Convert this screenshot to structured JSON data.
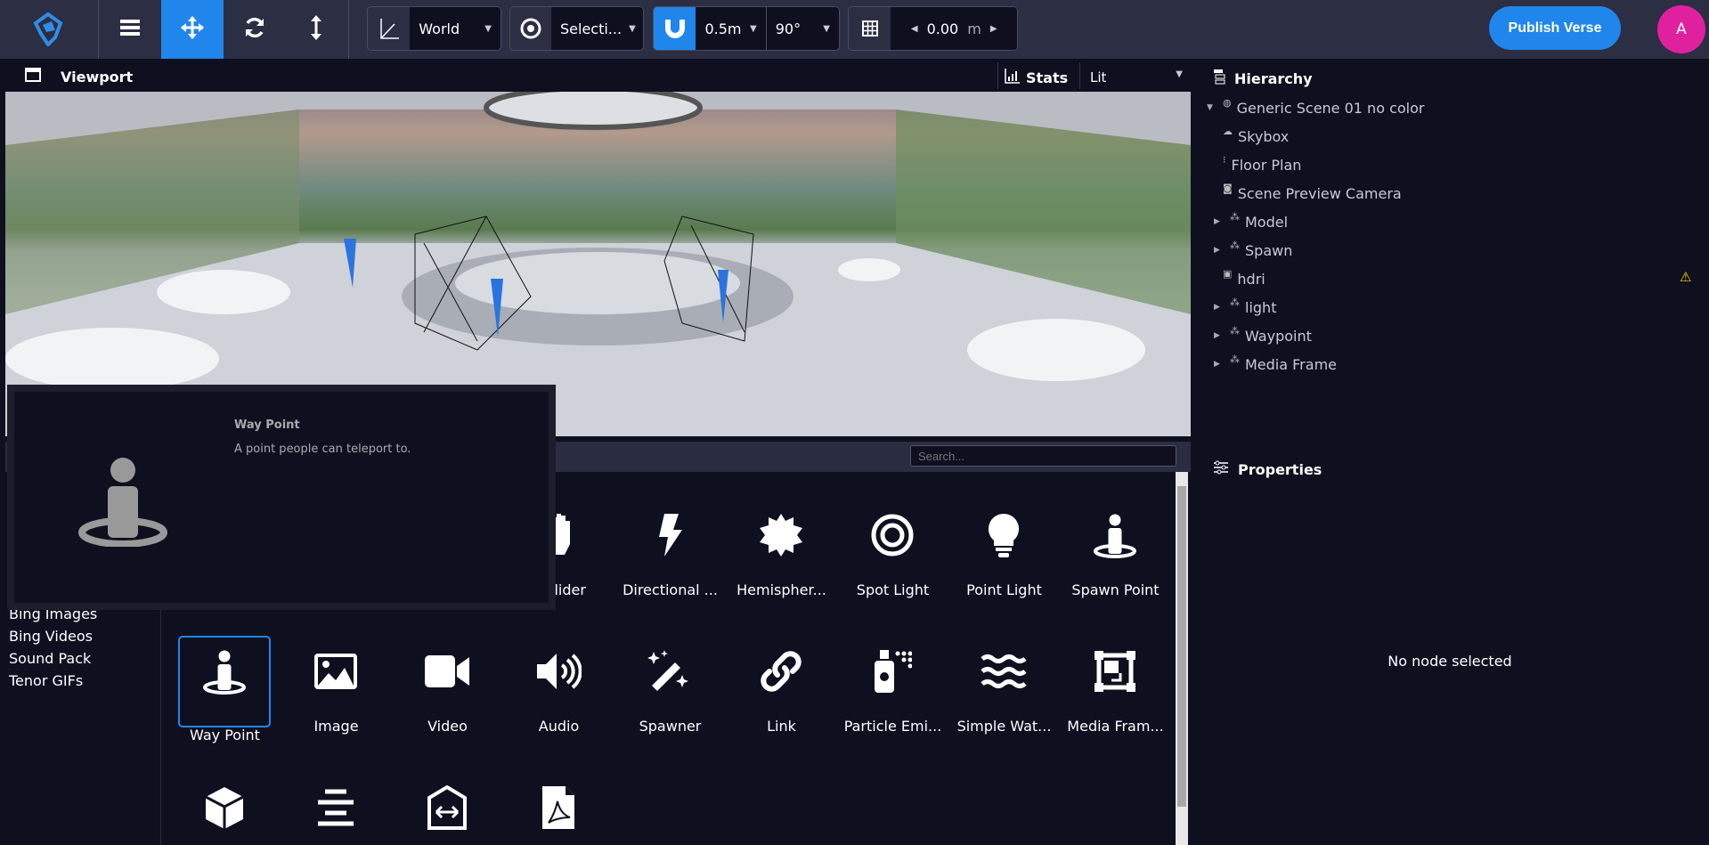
{
  "toolbar": {
    "transform_space": "World",
    "pivot": "Selecti...",
    "snap_distance": "0.5m",
    "snap_angle": "90°",
    "grid_value": "0.00",
    "grid_unit": "m",
    "publish_label": "Publish Verse",
    "avatar_initial": "A",
    "accent": "#2186eb"
  },
  "viewport": {
    "title": "Viewport",
    "stats_label": "Stats",
    "render_mode": "Lit"
  },
  "hierarchy": {
    "title": "Hierarchy",
    "items": [
      {
        "label": "Generic Scene 01 no color",
        "icon": "globe-icon",
        "expander": "expanded"
      },
      {
        "label": "Skybox",
        "icon": "cloud-icon"
      },
      {
        "label": "Floor Plan",
        "icon": "floor-plan-icon"
      },
      {
        "label": "Scene Preview Camera",
        "icon": "camera-icon"
      },
      {
        "label": "Model",
        "icon": "objects-icon",
        "expander": "collapsed"
      },
      {
        "label": "Spawn",
        "icon": "objects-icon",
        "expander": "collapsed"
      },
      {
        "label": "hdri",
        "icon": "image-icon",
        "warning": true
      },
      {
        "label": "light",
        "icon": "objects-icon",
        "expander": "collapsed"
      },
      {
        "label": "Waypoint",
        "icon": "objects-icon",
        "expander": "collapsed"
      },
      {
        "label": "Media Frame",
        "icon": "objects-icon",
        "expander": "collapsed"
      }
    ]
  },
  "properties": {
    "title": "Properties",
    "empty_text": "No node selected"
  },
  "assets": {
    "search_placeholder": "Search...",
    "categories": [
      "Bing Images",
      "Bing Videos",
      "Sound Pack",
      "Tenor GIFs"
    ],
    "rows": [
      [
        {
          "label": "Collider",
          "icon": "hand-icon"
        },
        {
          "label": "Directional ...",
          "icon": "bolt-icon"
        },
        {
          "label": "Hemispher...",
          "icon": "burst-icon"
        },
        {
          "label": "Spot Light",
          "icon": "target-icon"
        },
        {
          "label": "Point Light",
          "icon": "lightbulb-icon"
        },
        {
          "label": "Spawn Point",
          "icon": "person-pin-icon"
        }
      ],
      [
        {
          "label": "Way Point",
          "icon": "person-pin-icon",
          "selected": true
        },
        {
          "label": "Image",
          "icon": "image-icon"
        },
        {
          "label": "Video",
          "icon": "video-icon"
        },
        {
          "label": "Audio",
          "icon": "volume-icon"
        },
        {
          "label": "Spawner",
          "icon": "magic-wand-icon"
        },
        {
          "label": "Link",
          "icon": "link-icon"
        },
        {
          "label": "Particle Emi...",
          "icon": "spray-icon"
        },
        {
          "label": "Simple Wat...",
          "icon": "water-icon"
        },
        {
          "label": "Media Fram...",
          "icon": "media-frame-icon"
        }
      ],
      [
        {
          "icon": "cube-icon"
        },
        {
          "icon": "align-center-icon"
        },
        {
          "icon": "portal-icon"
        },
        {
          "icon": "pdf-icon"
        }
      ]
    ]
  },
  "tooltip": {
    "title": "Way Point",
    "description": "A point people can teleport to.",
    "icon": "person-pin-icon"
  }
}
